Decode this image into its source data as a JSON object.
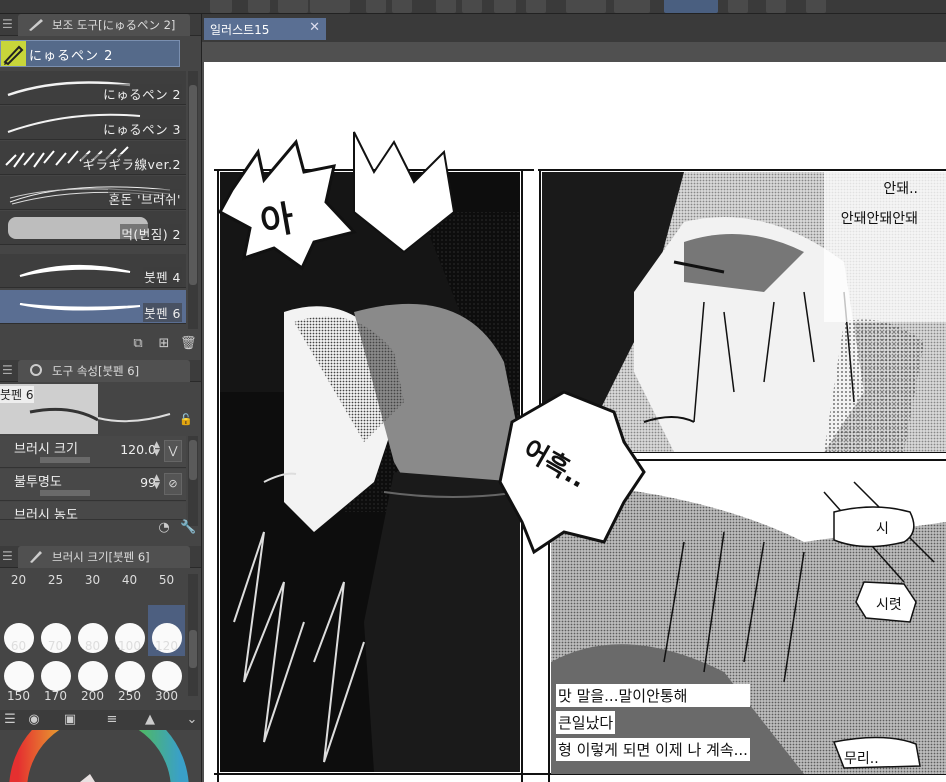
{
  "left_panel": {
    "subtool_panel": {
      "header": "보조 도구[にゅるペン 2]",
      "selected": "にゅるペン 2",
      "brushes": [
        {
          "label": "にゅるペン 2",
          "selected": false
        },
        {
          "label": "にゅるペン 3",
          "selected": false
        },
        {
          "label": "ギラギラ線ver.2",
          "selected": false
        },
        {
          "label": "혼돈 '브러쉬'",
          "selected": false
        },
        {
          "label": "먹(번짐) 2",
          "selected": false
        },
        {
          "label": "붓펜 4",
          "selected": false
        },
        {
          "label": "붓펜 6",
          "selected": true
        }
      ]
    },
    "tool_property": {
      "header": "도구 속성[붓펜 6]",
      "preview_label": "붓펜 6",
      "rows": [
        {
          "label": "브러시 크기",
          "value": "120.0"
        },
        {
          "label": "불투명도",
          "value": "99"
        },
        {
          "label": "브러시 농도",
          "value": ""
        }
      ]
    },
    "brush_size": {
      "header": "브러시 크기[붓펜 6]",
      "top_labels": [
        "20",
        "25",
        "30",
        "40",
        "50"
      ],
      "rows": [
        [
          "60",
          "70",
          "80",
          "100",
          "120"
        ],
        [
          "150",
          "170",
          "200",
          "250",
          "300"
        ]
      ],
      "selected": "120"
    }
  },
  "document": {
    "tab_title": "일러스트15",
    "close_label": "✕"
  },
  "canvas": {
    "sfx_left": "아",
    "sfx_mid": "어흑..",
    "dialogue_top_right": [
      "안돼..",
      "안돼안돼안돼"
    ],
    "bubble_si": "시",
    "bubble_sireot": "시렷",
    "bubble_muri": "무리..",
    "narration": [
      "맛 말을...말이안통해",
      "큰일났다",
      "형 이렇게 되면 이제 나 계속..."
    ]
  },
  "colors": {
    "accent": "#5a6f93",
    "panel_bg": "#454545",
    "selected_brush": "#5a6e92"
  }
}
